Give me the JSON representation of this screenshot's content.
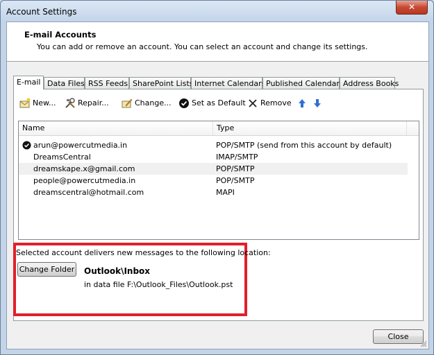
{
  "window": {
    "title": "Account Settings",
    "close_glyph": "✕"
  },
  "header": {
    "title": "E-mail Accounts",
    "subtitle": "You can add or remove an account. You can select an account and change its settings."
  },
  "tabs": [
    {
      "label": "E-mail",
      "active": true
    },
    {
      "label": "Data Files"
    },
    {
      "label": "RSS Feeds"
    },
    {
      "label": "SharePoint Lists"
    },
    {
      "label": "Internet Calendars"
    },
    {
      "label": "Published Calendars"
    },
    {
      "label": "Address Books"
    }
  ],
  "toolbar": {
    "new_label": "New...",
    "repair_label": "Repair...",
    "change_label": "Change...",
    "set_default_label": "Set as Default",
    "remove_label": "Remove",
    "icons": {
      "new": "new-mail-icon",
      "repair": "repair-tools-icon",
      "change": "change-icon",
      "set_default": "checkmark-circle-icon",
      "remove": "x-remove-icon",
      "up": "arrow-up-icon",
      "down": "arrow-down-icon"
    }
  },
  "accounts_table": {
    "columns": [
      "Name",
      "Type"
    ],
    "rows": [
      {
        "name": "arun@powercutmedia.in",
        "type": "POP/SMTP (send from this account by default)",
        "is_default": true
      },
      {
        "name": "DreamsCentral",
        "type": "IMAP/SMTP"
      },
      {
        "name": "dreamskape.x@gmail.com",
        "type": "POP/SMTP",
        "highlighted": true
      },
      {
        "name": "people@powercutmedia.in",
        "type": "POP/SMTP"
      },
      {
        "name": "dreamscentral@hotmail.com",
        "type": "MAPI"
      }
    ]
  },
  "delivery": {
    "description": "Selected account delivers new messages to the following location:",
    "change_folder_label": "Change Folder",
    "folder": "Outlook\\Inbox",
    "data_file": "in data file F:\\Outlook_Files\\Outlook.pst"
  },
  "footer": {
    "close_label": "Close"
  },
  "colors": {
    "highlight_box": "#e0202a",
    "accent_arrow": "#2f6fd6"
  }
}
